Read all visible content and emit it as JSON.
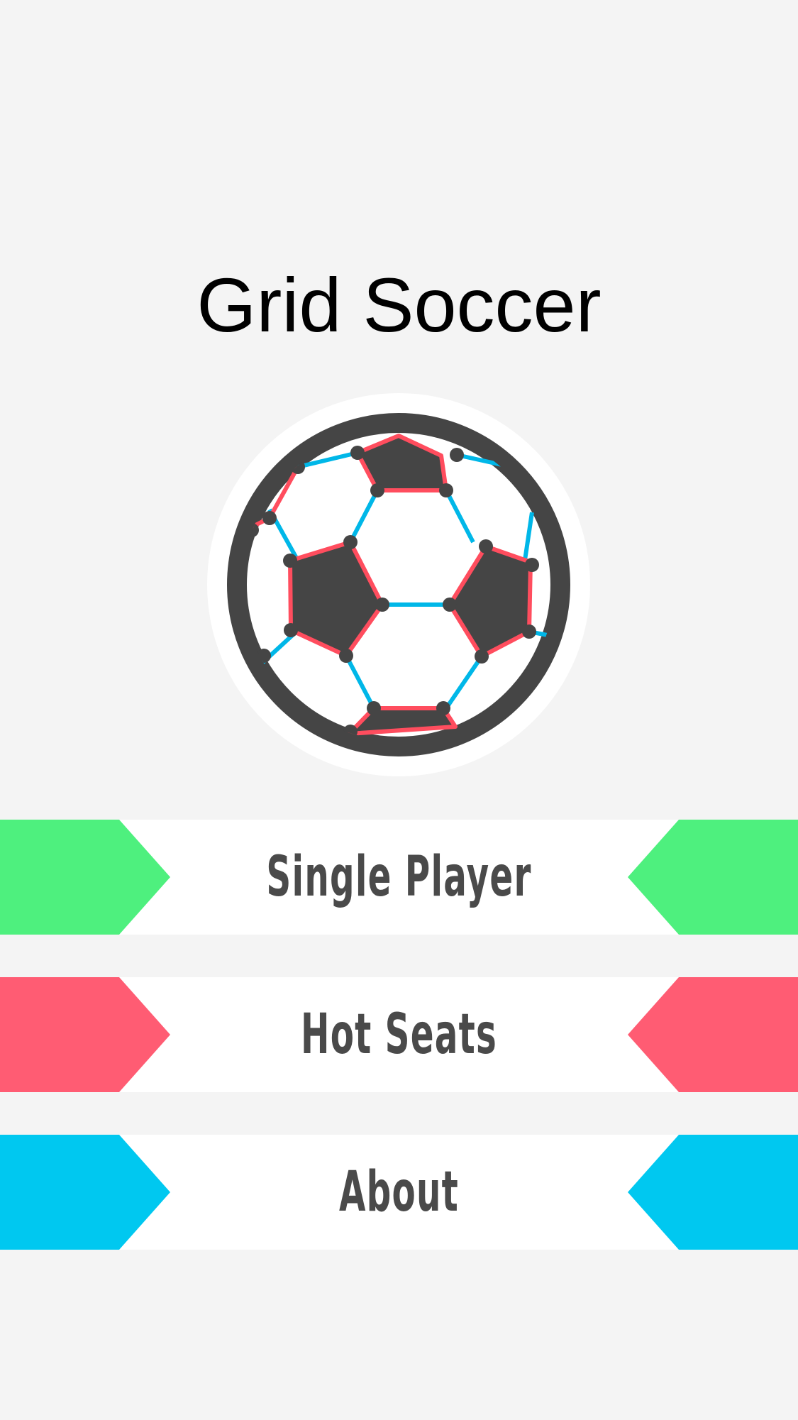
{
  "app": {
    "title": "Grid Soccer"
  },
  "logo": {
    "icon": "soccer-ball-icon",
    "colors": {
      "ring": "#454545",
      "outline": "#ffffff",
      "red_edges": "#ff4d5e",
      "blue_edges": "#00b7e8"
    }
  },
  "menu": {
    "items": [
      {
        "id": "single-player",
        "label": "Single Player",
        "accent": "#4ef07e"
      },
      {
        "id": "hot-seats",
        "label": "Hot Seats",
        "accent": "#ff5c73"
      },
      {
        "id": "about",
        "label": "About",
        "accent": "#00c8f0"
      }
    ]
  }
}
